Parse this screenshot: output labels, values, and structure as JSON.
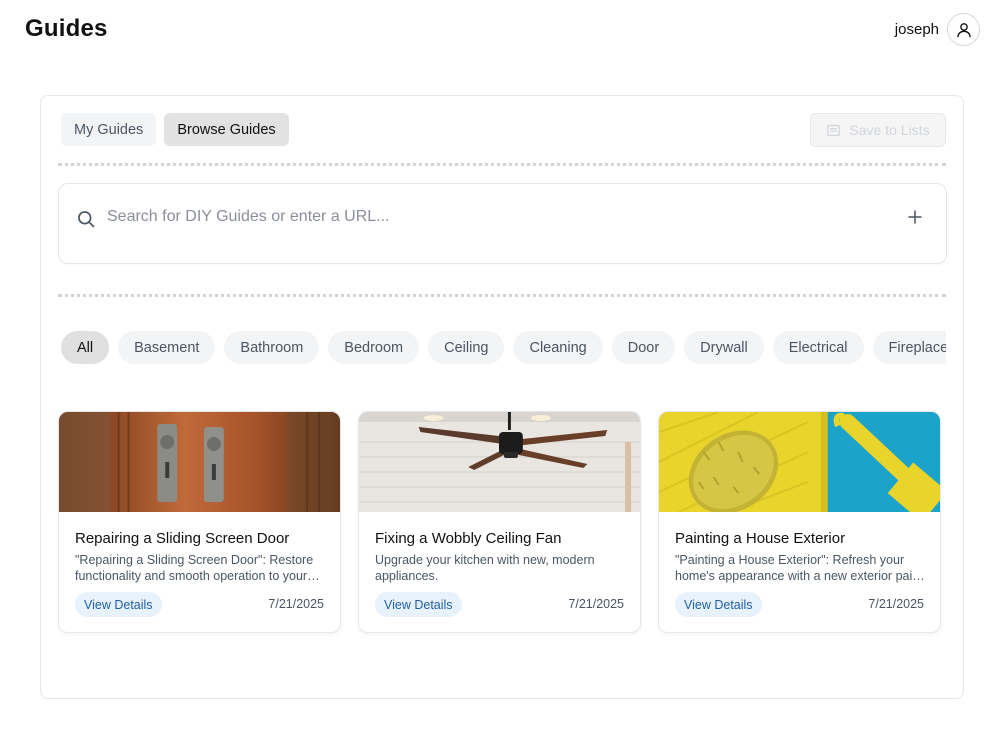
{
  "header": {
    "title": "Guides",
    "user_name": "joseph"
  },
  "tabs": [
    {
      "label": "My Guides",
      "active": false
    },
    {
      "label": "Browse Guides",
      "active": true
    }
  ],
  "save_button": {
    "label": "Save to Lists",
    "disabled": true
  },
  "search": {
    "placeholder": "Search for DIY Guides or enter a URL...",
    "value": ""
  },
  "categories": [
    {
      "label": "All",
      "selected": true
    },
    {
      "label": "Basement"
    },
    {
      "label": "Bathroom"
    },
    {
      "label": "Bedroom"
    },
    {
      "label": "Ceiling"
    },
    {
      "label": "Cleaning"
    },
    {
      "label": "Door"
    },
    {
      "label": "Drywall"
    },
    {
      "label": "Electrical"
    },
    {
      "label": "Fireplace"
    }
  ],
  "cards": [
    {
      "title": "Repairing a Sliding Screen Door",
      "description": "\"Repairing a Sliding Screen Door\": Restore functionality and smooth operation to your sliding screen door.",
      "button_label": "View Details",
      "date": "7/21/2025",
      "image": "door-lock-photo"
    },
    {
      "title": "Fixing a Wobbly Ceiling Fan",
      "description": "Upgrade your kitchen with new, modern appliances.",
      "button_label": "View Details",
      "date": "7/21/2025",
      "image": "ceiling-fan-photo"
    },
    {
      "title": "Painting a House Exterior",
      "description": "\"Painting a House Exterior\": Refresh your home's appearance with a new exterior paint job.",
      "button_label": "View Details",
      "date": "7/21/2025",
      "image": "paint-roller-photo"
    }
  ],
  "colors": {
    "accent_link": "#1f5fa8",
    "accent_link_bg": "#e8f2fc",
    "chip_bg": "#f3f4f6",
    "chip_selected_bg": "#e0e0e0"
  }
}
